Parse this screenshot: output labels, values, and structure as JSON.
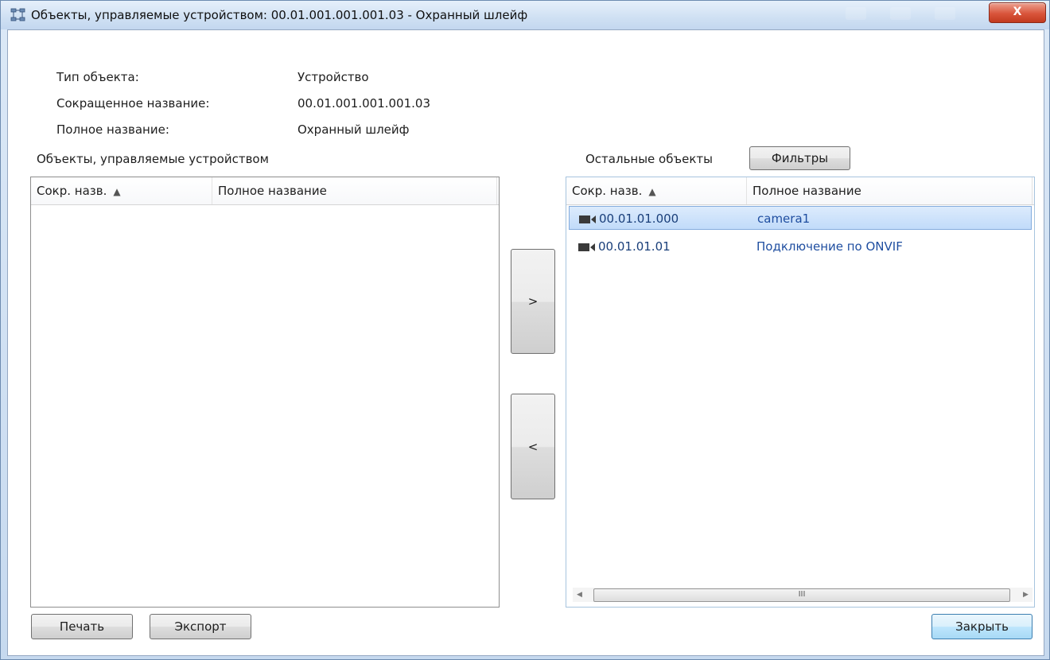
{
  "window": {
    "title": "Объекты, управляемые устройством: 00.01.001.001.001.03 - Охранный шлейф",
    "close_label": "X",
    "app_icon": "device-tree-icon"
  },
  "info": {
    "type_label": "Тип объекта:",
    "type_value": "Устройство",
    "short_label": "Сокращенное название:",
    "short_value": "00.01.001.001.001.03",
    "full_label": "Полное название:",
    "full_value": "Охранный шлейф"
  },
  "left_panel": {
    "title": "Объекты, управляемые устройством",
    "columns": [
      "Сокр. назв.",
      "Полное название"
    ],
    "rows": []
  },
  "right_panel": {
    "title": "Остальные объекты",
    "filters_label": "Фильтры",
    "columns": [
      "Сокр. назв.",
      "Полное название"
    ],
    "rows": [
      {
        "code": "00.01.01.000",
        "name": "camera1",
        "icon": "camera-icon",
        "selected": true
      },
      {
        "code": "00.01.01.01",
        "name": "Подключение по ONVIF",
        "icon": "camera-icon",
        "selected": false
      }
    ],
    "scroll_thumb_grip": "III"
  },
  "transfer": {
    "add_label": ">",
    "remove_label": "<"
  },
  "footer": {
    "print_label": "Печать",
    "export_label": "Экспорт",
    "close_label": "Закрыть"
  },
  "colors": {
    "accent": "#3c7fb1",
    "selection": "#c1dbfa",
    "close": "#c23a1f"
  }
}
